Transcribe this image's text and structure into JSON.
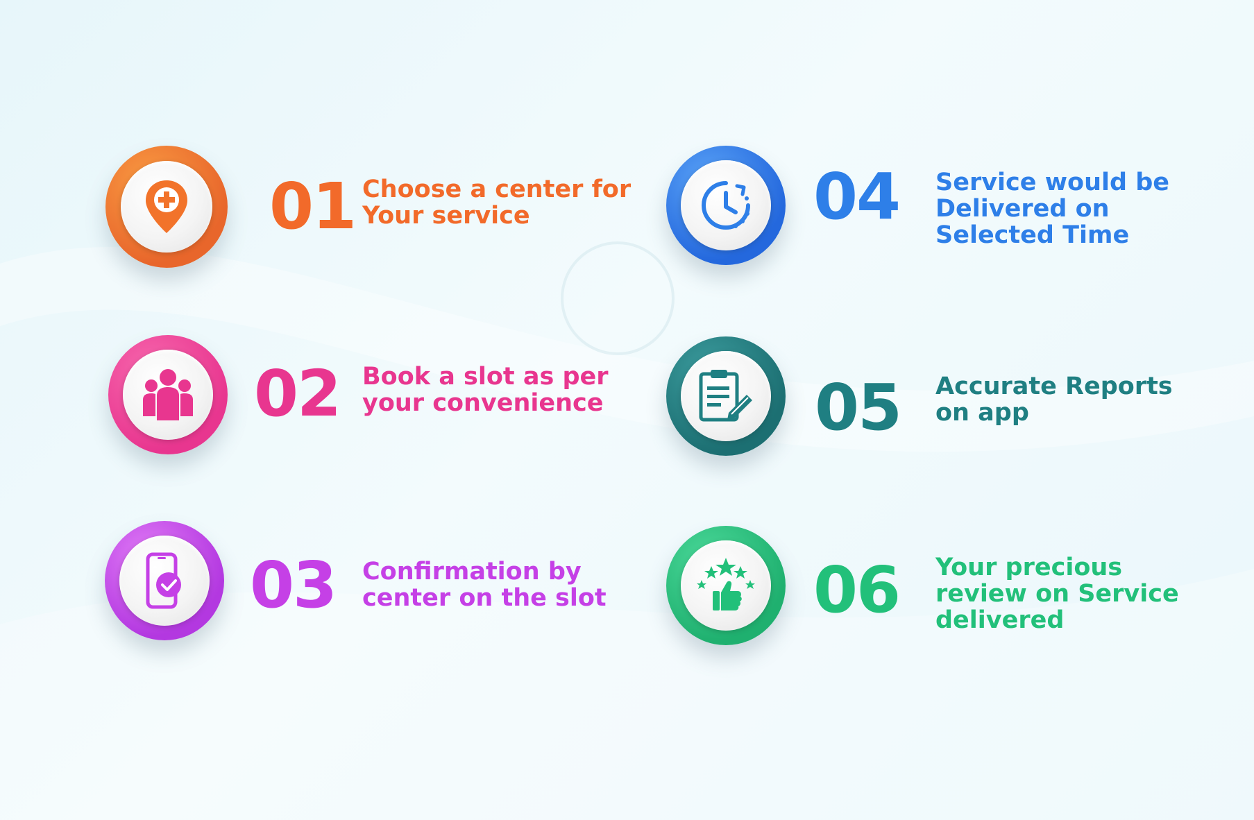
{
  "steps": [
    {
      "number": "01",
      "lines": [
        "Choose a center for",
        "Your service"
      ],
      "color": "#f26a2a",
      "ring": [
        "#f7892c",
        "#e8662b"
      ],
      "icon": "location-pin-plus-icon"
    },
    {
      "number": "02",
      "lines": [
        "Book a slot as per",
        "your convenience"
      ],
      "color": "#e8368f",
      "ring": [
        "#f24f9a",
        "#e8368f"
      ],
      "icon": "people-group-icon"
    },
    {
      "number": "03",
      "lines": [
        "Confirmation by",
        "center on the slot"
      ],
      "color": "#c540e6",
      "ring": [
        "#d85cf2",
        "#b338e0"
      ],
      "icon": "phone-check-icon"
    },
    {
      "number": "04",
      "lines": [
        "Service would be",
        "Delivered on",
        "Selected Time"
      ],
      "color": "#2e7fe8",
      "ring": [
        "#3a8cf3",
        "#2468dd"
      ],
      "icon": "clock-icon"
    },
    {
      "number": "05",
      "lines": [
        "Accurate Reports",
        "on app"
      ],
      "color": "#1f7f82",
      "ring": [
        "#2a8a8c",
        "#1c6f72"
      ],
      "icon": "clipboard-edit-icon"
    },
    {
      "number": "06",
      "lines": [
        "Your precious",
        "review on Service",
        "delivered"
      ],
      "color": "#22c07a",
      "ring": [
        "#2dcc85",
        "#1fb06f"
      ],
      "icon": "thumbs-up-stars-icon"
    }
  ]
}
